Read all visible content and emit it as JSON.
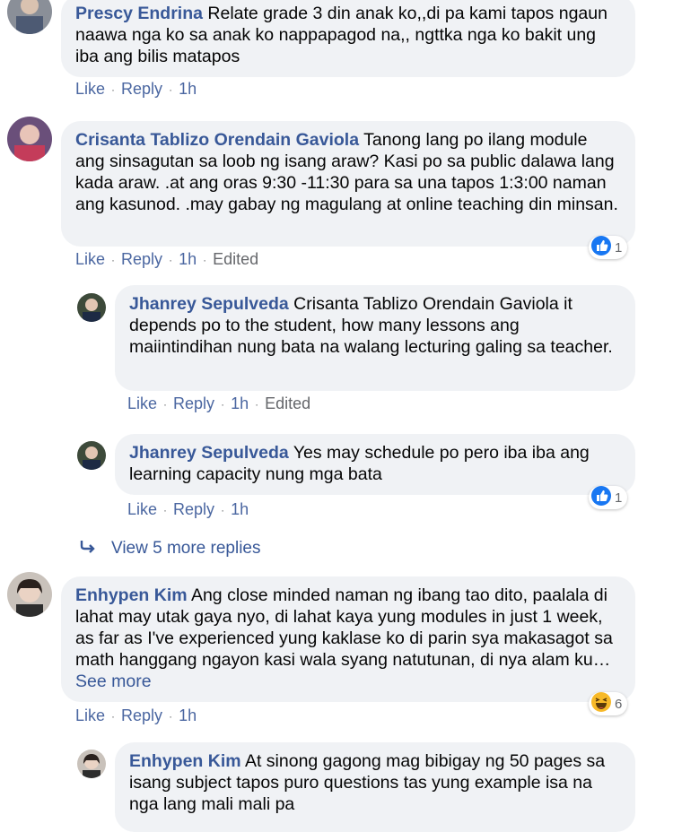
{
  "comments": [
    {
      "author": "Prescy Endrina",
      "text": "Relate grade 3 din anak ko,,di pa kami tapos ngaun naawa nga ko sa anak ko nappapagod na,, ngttka nga ko bakit ung iba ang bilis matapos",
      "actions": {
        "like": "Like",
        "reply": "Reply",
        "time": "1h"
      }
    },
    {
      "author": "Crisanta Tablizo Orendain Gaviola",
      "text": "Tanong lang po ilang module ang sinsagutan sa loob ng isang araw? Kasi po sa public dalawa lang kada araw. .at ang oras 9:30 -11:30 para sa una tapos 1:3:00 naman ang kasunod. .may gabay ng magulang at online teaching din minsan.",
      "actions": {
        "like": "Like",
        "reply": "Reply",
        "time": "1h",
        "edited": "Edited"
      },
      "reaction": {
        "icon": "like-icon",
        "count": "1"
      }
    },
    {
      "author": "Jhanrey Sepulveda",
      "text": "Crisanta Tablizo Orendain Gaviola it depends po to the student, how many lessons ang maiintindihan nung bata na walang lecturing galing sa teacher.",
      "actions": {
        "like": "Like",
        "reply": "Reply",
        "time": "1h",
        "edited": "Edited"
      }
    },
    {
      "author": "Jhanrey Sepulveda",
      "text": "Yes may schedule po pero iba iba ang learning capacity nung mga bata",
      "actions": {
        "like": "Like",
        "reply": "Reply",
        "time": "1h"
      },
      "reaction": {
        "icon": "like-icon",
        "count": "1"
      }
    },
    {
      "author": "Enhypen Kim",
      "text": "Ang close minded naman ng ibang tao dito, paalala di lahat may utak gaya nyo, di lahat kaya yung modules in just 1 week, as far as I've experienced yung kaklase ko di parin sya makasagot sa math hanggang ngayon kasi wala syang natutunan, di nya alam ku…",
      "see_more": "See more",
      "actions": {
        "like": "Like",
        "reply": "Reply",
        "time": "1h"
      },
      "reaction": {
        "icon": "haha-icon",
        "count": "6"
      }
    },
    {
      "author": "Enhypen Kim",
      "text": "At sinong gagong mag bibigay ng 50 pages sa isang subject tapos puro questions tas yung example isa na nga lang mali mali pa"
    }
  ],
  "view_more_replies": "View 5 more replies",
  "colors": {
    "link": "#385898",
    "bubble": "#f0f2f5",
    "meta": "#65676b",
    "like_blue": "#1877f2"
  }
}
